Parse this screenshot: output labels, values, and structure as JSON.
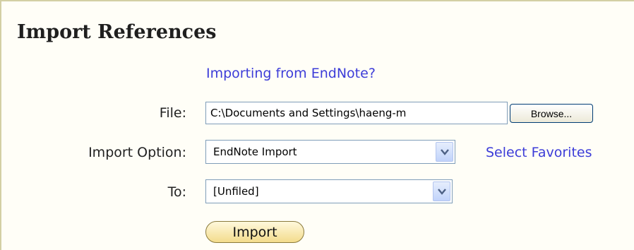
{
  "title": "Import References",
  "endnote_link": "Importing from EndNote?",
  "file": {
    "label": "File:",
    "value": "C:\\Documents and Settings\\haeng-m",
    "browse_label": "Browse..."
  },
  "import_option": {
    "label": "Import Option:",
    "selected": "EndNote Import",
    "favorites_link": "Select Favorites"
  },
  "to": {
    "label": "To:",
    "selected": "[Unfiled]"
  },
  "import_button": "Import",
  "colors": {
    "link": "#3c3cd8",
    "panel_border": "#d3cfa4",
    "button_fill": "#f3dc8c"
  },
  "icons": {
    "dropdown": "chevron-down-icon"
  }
}
